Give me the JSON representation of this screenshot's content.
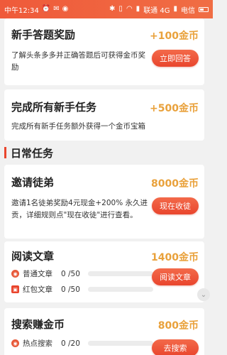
{
  "status_bar": {
    "time": "中午12:34",
    "left_icons": [
      "alarm-icon",
      "message-icon",
      "chat-icon"
    ],
    "right_text_carrier": "联通 4G",
    "right_text_carrier2": "电信",
    "right_icons": [
      "bluetooth-icon",
      "vibrate-icon",
      "wifi-icon",
      "signal-icon",
      "signal-icon",
      "battery-icon"
    ]
  },
  "cards": {
    "quiz": {
      "title": "新手答题奖励",
      "reward": "+100金币",
      "desc_line1": "了解头条多多并正确答题后可获得金币奖",
      "desc_line2": "励",
      "button": "立即回答"
    },
    "newbie_tasks": {
      "title": "完成所有新手任务",
      "reward": "+500金币",
      "desc": "完成所有新手任务额外获得一个金币宝箱"
    },
    "invite": {
      "title": "邀请徒弟",
      "reward": "8000金币",
      "desc_line1": "邀请1名徒弟奖励4元现金+200% 永久进",
      "desc_line2": "贡，详细规则点\"现在收徒\"进行查看。",
      "button": "现在收徒"
    },
    "read": {
      "title": "阅读文章",
      "reward": "1400金币",
      "button": "阅读文章",
      "rows": [
        {
          "label": "普通文章",
          "count": "0 /50",
          "progress": 0
        },
        {
          "label": "红包文章",
          "count": "0 /50",
          "progress": 0
        }
      ]
    },
    "search": {
      "title": "搜索赚金币",
      "reward": "800金币",
      "button": "去搜索",
      "rows": [
        {
          "label": "热点搜索",
          "count": "0 /20",
          "progress": 0
        }
      ]
    }
  },
  "section": {
    "daily_tasks": "日常任务"
  },
  "colors": {
    "accent": "#e9452d",
    "reward": "#e9a13b",
    "status_bar": "#ef5a3a"
  }
}
